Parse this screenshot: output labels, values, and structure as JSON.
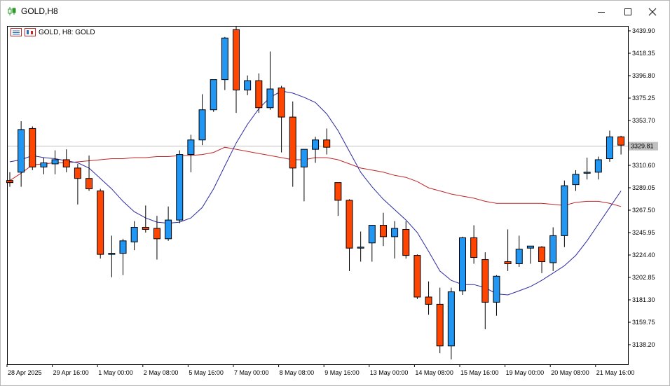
{
  "window": {
    "title": "GOLD,H8",
    "icon": "candlestick-chart-icon",
    "buttons": [
      "minimize-icon",
      "maximize-icon",
      "close-icon"
    ]
  },
  "chart_label": {
    "text": "GOLD, H8:  GOLD",
    "icons": [
      "trade-panel-icon",
      "indicator-icon"
    ]
  },
  "colors": {
    "bull": "#2196f3",
    "bear": "#ff4500",
    "ma_fast": "#2a2aa0",
    "ma_slow": "#c0282a",
    "grid": "#c0c0c0",
    "price_badge": "#c0c0c0"
  },
  "chart_data": {
    "type": "candlestick",
    "symbol": "GOLD",
    "timeframe": "H8",
    "ylim": [
      3121,
      3444
    ],
    "y_ticks": [
      "3439.90",
      "3418.35",
      "3396.80",
      "3375.25",
      "3353.70",
      "3310.60",
      "3289.05",
      "3267.50",
      "3245.95",
      "3224.40",
      "3202.85",
      "3181.30",
      "3159.75",
      "3138.20"
    ],
    "current_price": {
      "value": 3329,
      "label": "3329.81"
    },
    "x_labels": [
      {
        "index": 0,
        "label": "28 Apr 2025"
      },
      {
        "index": 4,
        "label": "29 Apr 16:00"
      },
      {
        "index": 8,
        "label": "1 May 00:00"
      },
      {
        "index": 12,
        "label": "2 May 08:00"
      },
      {
        "index": 16,
        "label": "5 May 16:00"
      },
      {
        "index": 20,
        "label": "7 May 00:00"
      },
      {
        "index": 24,
        "label": "8 May 08:00"
      },
      {
        "index": 28,
        "label": "9 May 16:00"
      },
      {
        "index": 32,
        "label": "13 May 00:00"
      },
      {
        "index": 36,
        "label": "14 May 08:00"
      },
      {
        "index": 40,
        "label": "15 May 16:00"
      },
      {
        "index": 44,
        "label": "19 May 00:00"
      },
      {
        "index": 48,
        "label": "20 May 08:00"
      },
      {
        "index": 52,
        "label": "21 May 16:00"
      }
    ],
    "candles": [
      {
        "o": 3296,
        "h": 3304,
        "l": 3290,
        "c": 3294
      },
      {
        "o": 3304,
        "h": 3353,
        "l": 3290,
        "c": 3345
      },
      {
        "o": 3346,
        "h": 3348,
        "l": 3306,
        "c": 3309
      },
      {
        "o": 3309,
        "h": 3318,
        "l": 3302,
        "c": 3313
      },
      {
        "o": 3312,
        "h": 3325,
        "l": 3302,
        "c": 3316
      },
      {
        "o": 3316,
        "h": 3326,
        "l": 3304,
        "c": 3309
      },
      {
        "o": 3308,
        "h": 3312,
        "l": 3273,
        "c": 3298
      },
      {
        "o": 3298,
        "h": 3320,
        "l": 3286,
        "c": 3288
      },
      {
        "o": 3286,
        "h": 3288,
        "l": 3221,
        "c": 3225
      },
      {
        "o": 3226,
        "h": 3243,
        "l": 3203,
        "c": 3226
      },
      {
        "o": 3226,
        "h": 3240,
        "l": 3205,
        "c": 3238
      },
      {
        "o": 3237,
        "h": 3257,
        "l": 3229,
        "c": 3251
      },
      {
        "o": 3251,
        "h": 3272,
        "l": 3246,
        "c": 3249
      },
      {
        "o": 3250,
        "h": 3262,
        "l": 3220,
        "c": 3240
      },
      {
        "o": 3240,
        "h": 3271,
        "l": 3238,
        "c": 3258
      },
      {
        "o": 3258,
        "h": 3325,
        "l": 3255,
        "c": 3321
      },
      {
        "o": 3321,
        "h": 3340,
        "l": 3304,
        "c": 3335
      },
      {
        "o": 3335,
        "h": 3379,
        "l": 3330,
        "c": 3364
      },
      {
        "o": 3364,
        "h": 3393,
        "l": 3362,
        "c": 3393
      },
      {
        "o": 3393,
        "h": 3434,
        "l": 3383,
        "c": 3433
      },
      {
        "o": 3441,
        "h": 3444,
        "l": 3361,
        "c": 3383
      },
      {
        "o": 3383,
        "h": 3397,
        "l": 3378,
        "c": 3392
      },
      {
        "o": 3392,
        "h": 3399,
        "l": 3361,
        "c": 3366
      },
      {
        "o": 3366,
        "h": 3420,
        "l": 3364,
        "c": 3384
      },
      {
        "o": 3385,
        "h": 3387,
        "l": 3323,
        "c": 3357
      },
      {
        "o": 3357,
        "h": 3372,
        "l": 3290,
        "c": 3308
      },
      {
        "o": 3309,
        "h": 3326,
        "l": 3276,
        "c": 3326
      },
      {
        "o": 3326,
        "h": 3338,
        "l": 3313,
        "c": 3335
      },
      {
        "o": 3335,
        "h": 3346,
        "l": 3321,
        "c": 3328
      },
      {
        "o": 3294,
        "h": 3294,
        "l": 3262,
        "c": 3277
      },
      {
        "o": 3277,
        "h": 3278,
        "l": 3209,
        "c": 3231
      },
      {
        "o": 3232,
        "h": 3247,
        "l": 3218,
        "c": 3232
      },
      {
        "o": 3236,
        "h": 3253,
        "l": 3218,
        "c": 3253
      },
      {
        "o": 3253,
        "h": 3265,
        "l": 3233,
        "c": 3242
      },
      {
        "o": 3242,
        "h": 3257,
        "l": 3221,
        "c": 3250
      },
      {
        "o": 3249,
        "h": 3257,
        "l": 3221,
        "c": 3224
      },
      {
        "o": 3224,
        "h": 3225,
        "l": 3182,
        "c": 3184
      },
      {
        "o": 3184,
        "h": 3199,
        "l": 3167,
        "c": 3177
      },
      {
        "o": 3177,
        "h": 3193,
        "l": 3130,
        "c": 3137
      },
      {
        "o": 3137,
        "h": 3193,
        "l": 3124,
        "c": 3189
      },
      {
        "o": 3190,
        "h": 3242,
        "l": 3186,
        "c": 3241
      },
      {
        "o": 3241,
        "h": 3253,
        "l": 3216,
        "c": 3222
      },
      {
        "o": 3220,
        "h": 3227,
        "l": 3153,
        "c": 3179
      },
      {
        "o": 3179,
        "h": 3205,
        "l": 3166,
        "c": 3204
      },
      {
        "o": 3218,
        "h": 3249,
        "l": 3209,
        "c": 3216
      },
      {
        "o": 3216,
        "h": 3243,
        "l": 3213,
        "c": 3230
      },
      {
        "o": 3231,
        "h": 3233,
        "l": 3216,
        "c": 3233
      },
      {
        "o": 3232,
        "h": 3233,
        "l": 3207,
        "c": 3218
      },
      {
        "o": 3217,
        "h": 3251,
        "l": 3209,
        "c": 3243
      },
      {
        "o": 3243,
        "h": 3296,
        "l": 3232,
        "c": 3291
      },
      {
        "o": 3292,
        "h": 3306,
        "l": 3286,
        "c": 3302
      },
      {
        "o": 3303,
        "h": 3318,
        "l": 3297,
        "c": 3304
      },
      {
        "o": 3304,
        "h": 3319,
        "l": 3297,
        "c": 3316
      },
      {
        "o": 3317,
        "h": 3344,
        "l": 3314,
        "c": 3338
      },
      {
        "o": 3338,
        "h": 3339,
        "l": 3321,
        "c": 3330
      }
    ],
    "ma_fast": [
      3314,
      3316,
      3320,
      3318,
      3317,
      3315,
      3313,
      3308,
      3298,
      3288,
      3276,
      3266,
      3260,
      3256,
      3255,
      3256,
      3260,
      3270,
      3288,
      3310,
      3332,
      3350,
      3365,
      3376,
      3382,
      3380,
      3376,
      3371,
      3360,
      3344,
      3324,
      3304,
      3290,
      3278,
      3268,
      3258,
      3246,
      3228,
      3209,
      3200,
      3196,
      3196,
      3193,
      3187,
      3186,
      3190,
      3194,
      3200,
      3207,
      3214,
      3224,
      3238,
      3254,
      3270,
      3286
    ],
    "ma_slow": [
      3296,
      3303,
      3311,
      3312,
      3313,
      3313,
      3314,
      3315,
      3316,
      3317,
      3317,
      3318,
      3318,
      3319,
      3319,
      3320,
      3320,
      3321,
      3323,
      3328,
      3326,
      3324,
      3322,
      3320,
      3318,
      3316,
      3316,
      3318,
      3318,
      3316,
      3312,
      3308,
      3306,
      3304,
      3301,
      3299,
      3295,
      3289,
      3286,
      3283,
      3281,
      3279,
      3276,
      3274,
      3274,
      3274,
      3274,
      3274,
      3273,
      3272,
      3275,
      3276,
      3276,
      3274,
      3271
    ]
  }
}
